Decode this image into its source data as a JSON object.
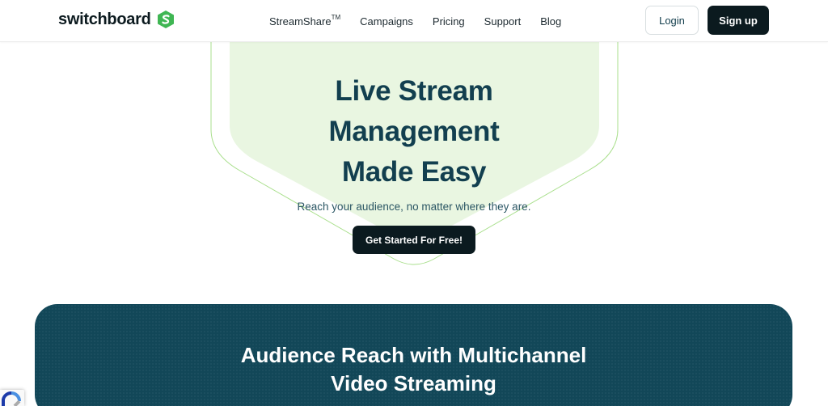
{
  "header": {
    "logo_text": "switchboard",
    "logo_icon": "switchboard-s-logo-icon",
    "nav": [
      {
        "label": "StreamShare",
        "sup": "TM"
      },
      {
        "label": "Campaigns"
      },
      {
        "label": "Pricing"
      },
      {
        "label": "Support"
      },
      {
        "label": "Blog"
      }
    ],
    "login_label": "Login",
    "signup_label": "Sign up"
  },
  "hero": {
    "title_lines": [
      "Live Stream",
      "Management",
      "Made Easy"
    ],
    "subtitle": "Reach your audience, no matter where they are.",
    "cta_label": "Get Started For Free!"
  },
  "feature": {
    "title_lines": [
      "Audience Reach with Multichannel",
      "Video Streaming"
    ]
  },
  "badges": {
    "recaptcha_icon": "recaptcha-icon"
  },
  "colors": {
    "brand_green": "#3fb653",
    "hero_bg": "#e9f6e1",
    "hero_outline": "#a9df8c",
    "dark": "#0b1a1f",
    "teal_band": "#124758",
    "heading": "#123f4f"
  }
}
